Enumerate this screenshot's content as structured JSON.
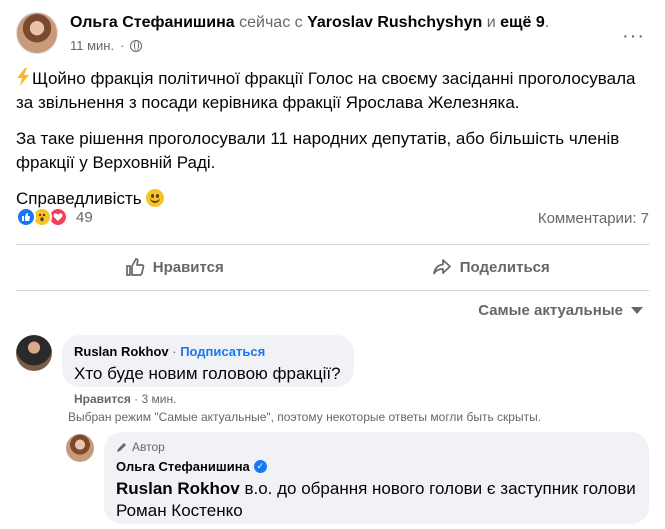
{
  "post": {
    "author": "Ольга Стефанишина",
    "with_text": " сейчас с ",
    "tagged": "Yaroslav Rushchyshyn",
    "and_text": " и ",
    "others": "ещё 9",
    "period": ".",
    "time": "11 мин.",
    "more_label": "···",
    "paragraph1": "Щойно фракція політичної фракції Голос на своєму засіданні проголосувала за звільнення з посади керівника фракції Ярослава Железняка.",
    "paragraph2": "За таке рішення проголосували 11 народних депутатів, або більшість членів фракції у Верховній Раді.",
    "paragraph3": "Справедливість"
  },
  "stats": {
    "reaction_count": "49",
    "comments": "Комментарии: 7",
    "reactions": [
      "like",
      "wow",
      "love"
    ]
  },
  "actions": {
    "like_label": "Нравится",
    "share_label": "Поделиться"
  },
  "sort": {
    "label": "Самые актуальные"
  },
  "comment": {
    "author": "Ruslan Rokhov",
    "separator": " · ",
    "subscribe": "Подписаться",
    "text": "Хто буде новим головою фракції?",
    "like_label": "Нравится",
    "time": " · 3 мин."
  },
  "notice": "Выбран режим \"Самые актуальные\", поэтому некоторые ответы могли быть скрыты.",
  "reply": {
    "badge": "Автор",
    "author": "Ольга Стефанишина",
    "mention": "Ruslan Rokhov",
    "text": " в.о. до обрання нового голови є заступник голови Роман Костенко"
  },
  "colors": {
    "accent": "#1877f2",
    "muted": "#65676b",
    "bubble": "#f0f2f5",
    "love": "#f33e58",
    "wow": "#f7c325"
  }
}
